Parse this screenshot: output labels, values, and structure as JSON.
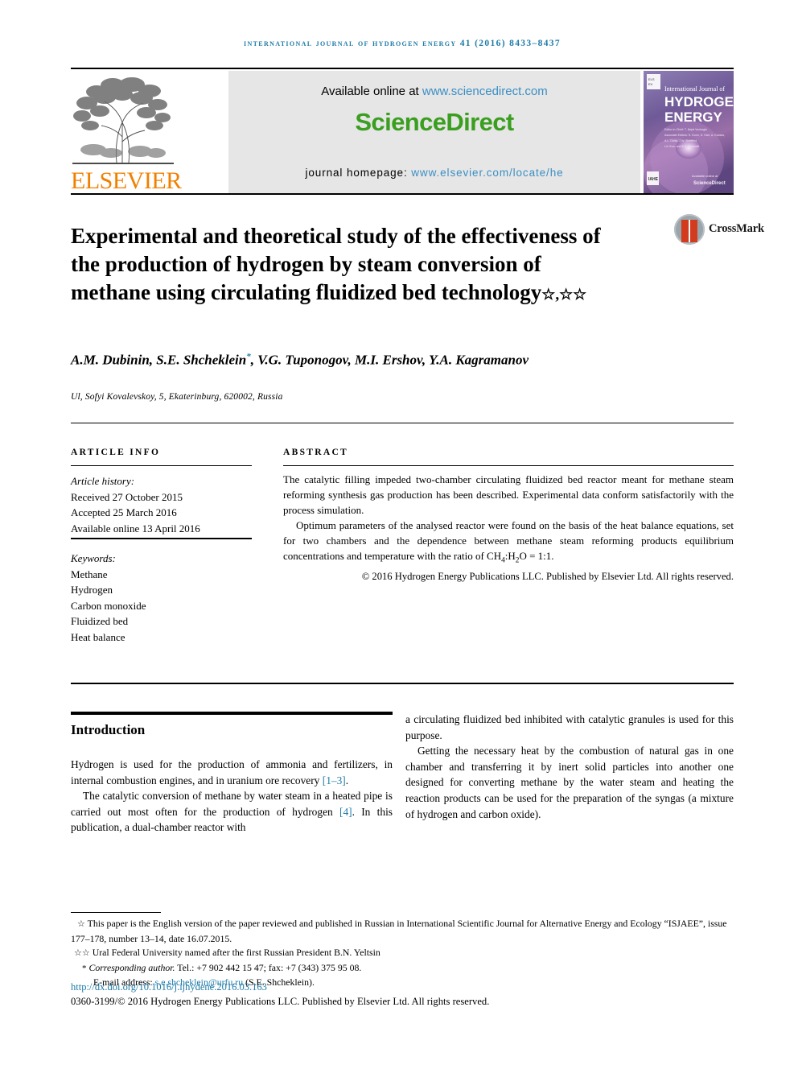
{
  "running_head": "International Journal of Hydrogen Energy 41 (2016) 8433–8437",
  "header": {
    "publisher_name": "ELSEVIER",
    "available_label": "Available online at",
    "sciencedirect_url": "www.sciencedirect.com",
    "sciencedirect_logo": "ScienceDirect",
    "homepage_label": "journal homepage:",
    "homepage_url": "www.elsevier.com/locate/he",
    "cover": {
      "line1": "International Journal of",
      "line2": "HYDROGEN",
      "line3": "ENERGY",
      "editors": "Editor-in-Chief: T. Nejat Veziroglu   Associate Editors: S. Dunn, D. Hart, A. Kovacs, A.L. Dicks, J.W. Sheffield, Lin Guo, and E.A. Ticianelli",
      "footer_badge": "IAHE",
      "footer_brand": "ScienceDirect"
    }
  },
  "article": {
    "title": "Experimental and theoretical study of the effectiveness of the production of hydrogen by steam conversion of methane using circulating fluidized bed technology",
    "title_marks": "☆,☆☆",
    "crossmark_label": "CrossMark",
    "authors": "A.M. Dubinin, S.E. Shcheklein",
    "authors_star": "*",
    "authors_rest": ", V.G. Tuponogov, M.I. Ershov, Y.A. Kagramanov",
    "affiliation": "Ul, Sofyi Kovalevskoy, 5, Ekaterinburg, 620002, Russia"
  },
  "article_info": {
    "heading": "ARTICLE INFO",
    "history_label": "Article history:",
    "received": "Received 27 October 2015",
    "accepted": "Accepted 25 March 2016",
    "available_online": "Available online 13 April 2016",
    "keywords_label": "Keywords:",
    "keywords": [
      "Methane",
      "Hydrogen",
      "Carbon monoxide",
      "Fluidized bed",
      "Heat balance"
    ]
  },
  "abstract": {
    "heading": "ABSTRACT",
    "paragraph1": "The catalytic filling impeded two-chamber circulating fluidized bed reactor meant for methane steam reforming synthesis gas production has been described. Experimental data conform satisfactorily with the process simulation.",
    "paragraph2_part1": "Optimum parameters of the analysed reactor were found on the basis of the heat balance equations, set for two chambers and the dependence between methane steam reforming products equilibrium concentrations and temperature with the ratio of CH",
    "paragraph2_sub1": "4",
    "paragraph2_part2": ":H",
    "paragraph2_sub2": "2",
    "paragraph2_part3": "O = 1:1.",
    "copyright": "© 2016 Hydrogen Energy Publications LLC. Published by Elsevier Ltd. All rights reserved."
  },
  "introduction": {
    "heading": "Introduction",
    "left_p1_a": "Hydrogen is used for the production of ammonia and fertilizers, in internal combustion engines, and in uranium ore recovery ",
    "left_p1_ref": "[1–3]",
    "left_p1_b": ".",
    "left_p2_a": "The catalytic conversion of methane by water steam in a heated pipe is carried out most often for the production of hydrogen ",
    "left_p2_ref": "[4]",
    "left_p2_b": ". In this publication, a dual-chamber reactor with",
    "right_p1": "a circulating fluidized bed inhibited with catalytic granules is used for this purpose.",
    "right_p2": "Getting the necessary heat by the combustion of natural gas in one chamber and transferring it by inert solid particles into another one designed for converting methane by the water steam and heating the reaction products can be used for the preparation of the syngas (a mixture of hydrogen and carbon oxide)."
  },
  "footnotes": {
    "note1_mark": "☆",
    "note1_text": "This paper is the English version of the paper reviewed and published in Russian in International Scientific Journal for Alternative Energy and Ecology “ISJAEE”, issue 177–178, number 13–14, date 16.07.2015.",
    "note2_mark": "☆☆",
    "note2_text": "Ural Federal University named after the first Russian President B.N. Yeltsin",
    "note3_mark": "*",
    "note3_italic": "Corresponding author.",
    "note3_text": " Tel.: +7 902 442 15 47; fax: +7 (343) 375 95 08.",
    "email_label": "E-mail address:",
    "email": "s.e.shcheklein@urfu.ru",
    "email_suffix": "(S.E. Shcheklein).",
    "doi": "http://dx.doi.org/10.1016/j.ijhydene.2016.03.163",
    "issn_line": "0360-3199/© 2016 Hydrogen Energy Publications LLC. Published by Elsevier Ltd. All rights reserved."
  },
  "colors": {
    "journal_blue": "#1f7ba8",
    "link_blue": "#3a8fc4",
    "sciencedirect_green": "#3a9e1f",
    "elsevier_orange": "#f08000",
    "band_grey": "#e6e6e6"
  }
}
